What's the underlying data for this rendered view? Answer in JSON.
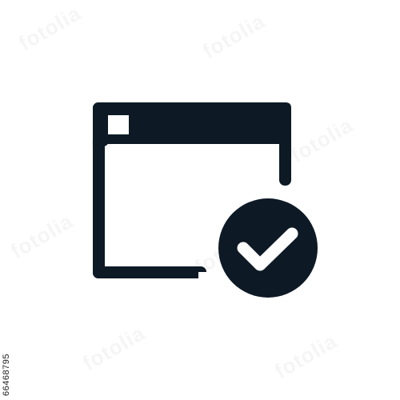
{
  "icon": {
    "name": "window-check-icon",
    "color": "#0d1a26",
    "background": "#ffffff",
    "accent_mark": "checkmark"
  },
  "watermark": {
    "logo_text": "fotolia"
  },
  "stock_id": "66468795"
}
